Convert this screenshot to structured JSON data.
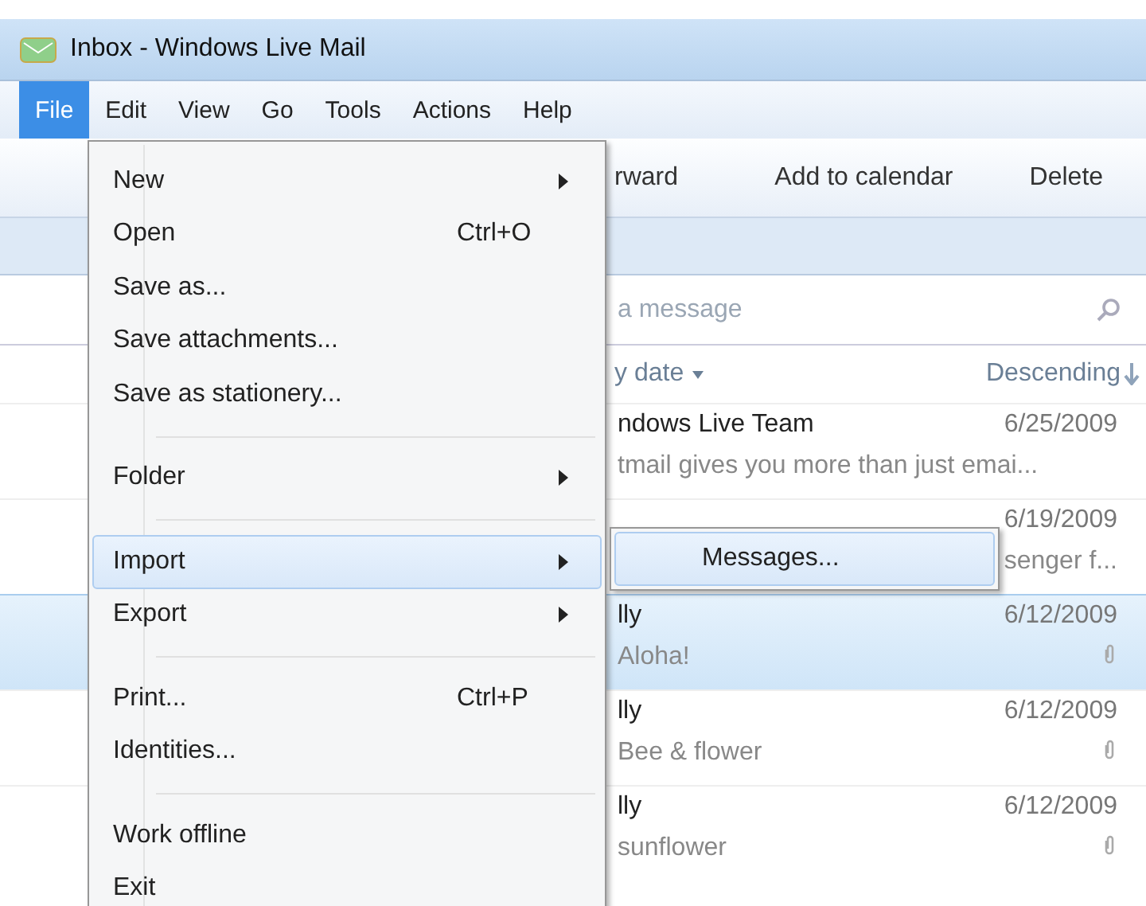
{
  "window": {
    "title": "Inbox - Windows Live Mail"
  },
  "menubar": [
    {
      "label": "File",
      "selected": true
    },
    {
      "label": "Edit",
      "selected": false
    },
    {
      "label": "View",
      "selected": false
    },
    {
      "label": "Go",
      "selected": false
    },
    {
      "label": "Tools",
      "selected": false
    },
    {
      "label": "Actions",
      "selected": false
    },
    {
      "label": "Help",
      "selected": false
    }
  ],
  "toolbar": [
    "rward",
    "Add to calendar",
    "Delete"
  ],
  "search": {
    "placeholder": "a message"
  },
  "sort": {
    "by": "y date",
    "order": "Descending"
  },
  "messages": [
    {
      "sender": "ndows Live Team",
      "date": "6/25/2009",
      "preview": "tmail gives you more than just emai...",
      "attachment": false,
      "selected": false
    },
    {
      "date": "6/19/2009",
      "preview": "senger f...",
      "attachment": false,
      "selected": false
    },
    {
      "sender": "lly",
      "date": "6/12/2009",
      "preview": "Aloha!",
      "attachment": true,
      "selected": true
    },
    {
      "sender": "lly",
      "date": "6/12/2009",
      "preview": "Bee & flower",
      "attachment": true,
      "selected": false
    },
    {
      "sender": "lly",
      "date": "6/12/2009",
      "preview": "sunflower",
      "attachment": true,
      "selected": false
    }
  ],
  "file_menu": [
    {
      "kind": "item",
      "label": "New",
      "submenu": true,
      "selected": false
    },
    {
      "kind": "item",
      "label": "Open",
      "shortcut": "Ctrl+O",
      "submenu": false,
      "selected": false
    },
    {
      "kind": "item",
      "label": "Save as...",
      "submenu": false,
      "selected": false
    },
    {
      "kind": "item",
      "label": "Save attachments...",
      "submenu": false,
      "selected": false
    },
    {
      "kind": "item",
      "label": "Save as stationery...",
      "submenu": false,
      "selected": false
    },
    {
      "kind": "separator"
    },
    {
      "kind": "item",
      "label": "Folder",
      "submenu": true,
      "selected": false
    },
    {
      "kind": "separator"
    },
    {
      "kind": "item",
      "label": "Import",
      "submenu": true,
      "selected": true
    },
    {
      "kind": "item",
      "label": "Export",
      "submenu": true,
      "selected": false
    },
    {
      "kind": "separator"
    },
    {
      "kind": "item",
      "label": "Print...",
      "shortcut": "Ctrl+P",
      "submenu": false,
      "selected": false
    },
    {
      "kind": "item",
      "label": "Identities...",
      "submenu": false,
      "selected": false
    },
    {
      "kind": "separator"
    },
    {
      "kind": "item",
      "label": "Work offline",
      "submenu": false,
      "selected": false
    },
    {
      "kind": "item",
      "label": "Exit",
      "submenu": false,
      "selected": false
    }
  ],
  "import_submenu": [
    {
      "label": "Messages...",
      "selected": true
    }
  ]
}
